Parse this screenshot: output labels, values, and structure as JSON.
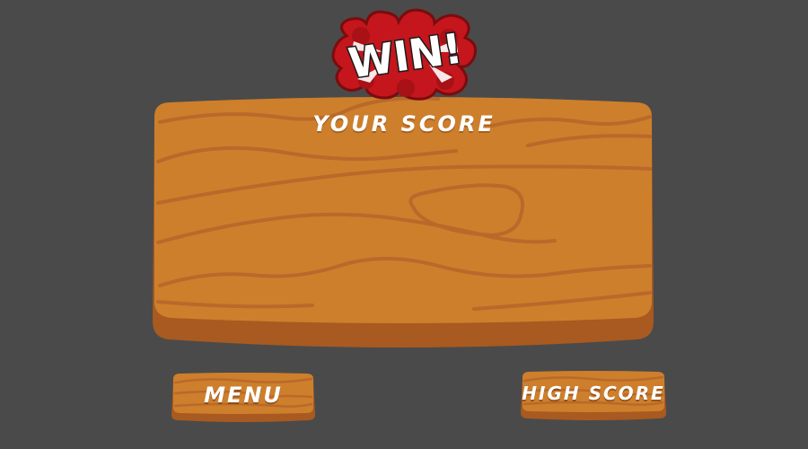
{
  "result_badge": {
    "text": "WIN!",
    "icon": "comic-burst-icon"
  },
  "board": {
    "score_label": "YOUR SCORE"
  },
  "buttons": {
    "menu_label": "MENU",
    "high_score_label": "HIGH SCORE"
  },
  "colors": {
    "background": "#4a4a4a",
    "wood": "#cd7f2c",
    "wood_grain": "#b9692a",
    "wood_edge": "#a85a20",
    "badge_red": "#c4161c",
    "badge_dark": "#7a0c0e",
    "text": "#ffffff"
  }
}
